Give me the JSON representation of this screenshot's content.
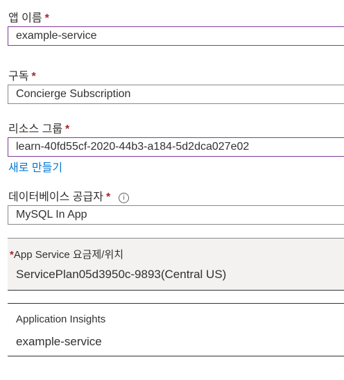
{
  "app_name": {
    "label": "앱 이름",
    "required": "*",
    "value": "example-service"
  },
  "subscription": {
    "label": "구독",
    "required": "*",
    "value": "Concierge Subscription"
  },
  "resource_group": {
    "label": "리소스 그룹",
    "required": "*",
    "value": "learn-40fd55cf-2020-44b3-a184-5d2dca027e02",
    "create_new_link": "새로 만들기"
  },
  "database_provider": {
    "label": "데이터베이스 공급자",
    "required": "*",
    "info_icon": "i",
    "value": "MySQL In App"
  },
  "app_service_plan": {
    "required": "*",
    "label": "App Service 요금제/위치",
    "value": "ServicePlan05d3950c-9893(Central US)"
  },
  "application_insights": {
    "label": "Application Insights",
    "value": "example-service"
  },
  "colors": {
    "required": "#a4262c",
    "link": "#0078d4",
    "focus_border": "#7d3c98",
    "panel_bg": "#f3f2f1"
  }
}
